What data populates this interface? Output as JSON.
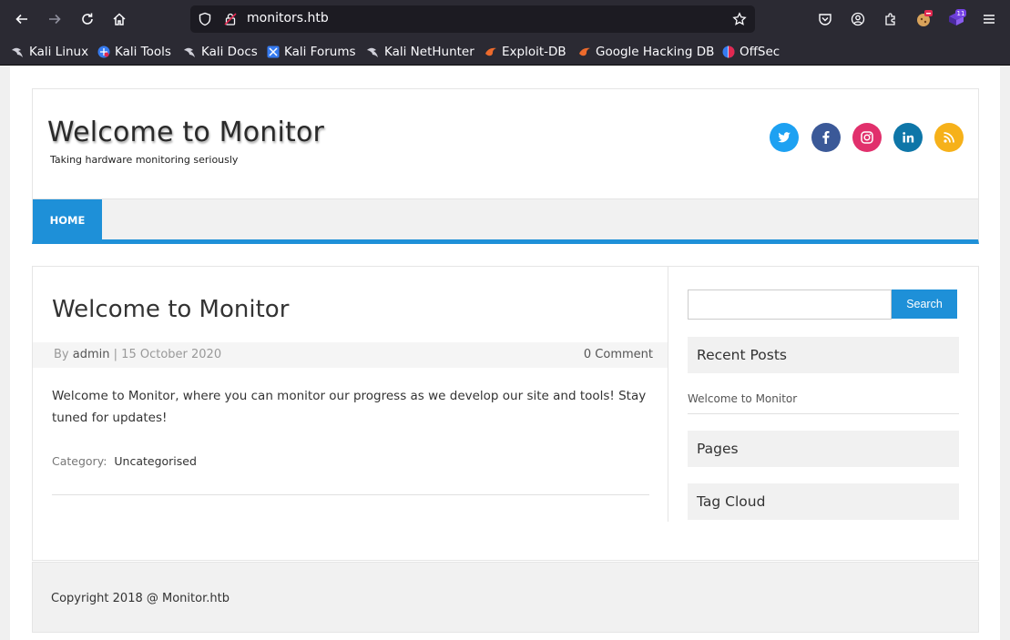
{
  "browser": {
    "url": "monitors.htb",
    "extension_badge": "11",
    "bookmarks": [
      {
        "label": "Kali Linux",
        "icon": "kali-dragon-icon"
      },
      {
        "label": "Kali Tools",
        "icon": "kali-tools-icon"
      },
      {
        "label": "Kali Docs",
        "icon": "kali-dragon-icon"
      },
      {
        "label": "Kali Forums",
        "icon": "kali-forums-icon"
      },
      {
        "label": "Kali NetHunter",
        "icon": "kali-dragon-icon"
      },
      {
        "label": "Exploit-DB",
        "icon": "exploit-db-icon"
      },
      {
        "label": "Google Hacking DB",
        "icon": "ghdb-icon"
      },
      {
        "label": "OffSec",
        "icon": "offsec-icon"
      }
    ]
  },
  "site": {
    "title": "Welcome to Monitor",
    "tagline": "Taking hardware monitoring seriously",
    "social": [
      "twitter",
      "facebook",
      "instagram",
      "linkedin",
      "rss"
    ],
    "colors": {
      "accent": "#1e90d8",
      "twitter": "#1da1f2",
      "facebook": "#3b5998",
      "instagram": "#e1306c",
      "linkedin": "#0e76a8",
      "rss": "#f6b11a"
    }
  },
  "nav": {
    "home": "HOME"
  },
  "post": {
    "title": "Welcome to Monitor",
    "by": "By",
    "author": "admin",
    "separator": "|",
    "date": "15 October 2020",
    "comments": "0 Comment",
    "body": "Welcome to Monitor, where you can monitor our progress as we develop our site and tools! Stay tuned for updates!",
    "category_label": "Category:",
    "category": "Uncategorised"
  },
  "sidebar": {
    "search_button": "Search",
    "search_placeholder": "",
    "recent_posts_title": "Recent Posts",
    "recent_posts": [
      "Welcome to Monitor"
    ],
    "pages_title": "Pages",
    "tag_cloud_title": "Tag Cloud"
  },
  "footer": {
    "copyright": "Copyright 2018 @ Monitor.htb"
  }
}
